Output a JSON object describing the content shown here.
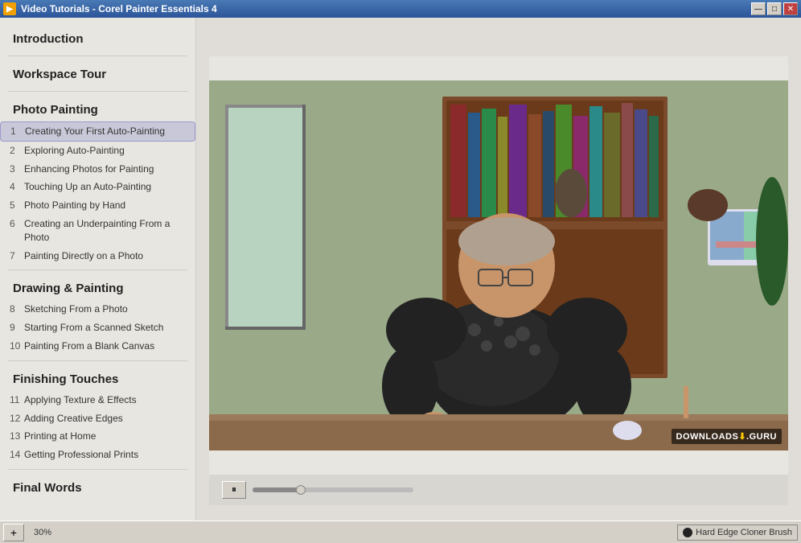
{
  "window": {
    "title": "Video Tutorials - Corel Painter Essentials 4",
    "controls": {
      "minimize": "—",
      "maximize": "□",
      "close": "✕"
    }
  },
  "sidebar": {
    "sections": [
      {
        "id": "intro",
        "title": "Introduction",
        "items": []
      },
      {
        "id": "workspace",
        "title": "Workspace Tour",
        "items": []
      },
      {
        "id": "photo-painting",
        "title": "Photo Painting",
        "items": [
          {
            "num": "1",
            "text": "Creating Your First Auto-Painting",
            "active": true
          },
          {
            "num": "2",
            "text": "Exploring Auto-Painting"
          },
          {
            "num": "3",
            "text": "Enhancing Photos for Painting"
          },
          {
            "num": "4",
            "text": "Touching Up an Auto-Painting"
          },
          {
            "num": "5",
            "text": "Photo Painting by Hand"
          },
          {
            "num": "6",
            "text": "Creating an Underpainting From a Photo"
          },
          {
            "num": "7",
            "text": "Painting Directly on a Photo"
          }
        ]
      },
      {
        "id": "drawing-painting",
        "title": "Drawing & Painting",
        "items": [
          {
            "num": "8",
            "text": "Sketching From a Photo"
          },
          {
            "num": "9",
            "text": "Starting From a Scanned Sketch"
          },
          {
            "num": "10",
            "text": "Painting From a Blank Canvas"
          }
        ]
      },
      {
        "id": "finishing-touches",
        "title": "Finishing Touches",
        "items": [
          {
            "num": "11",
            "text": "Applying Texture & Effects"
          },
          {
            "num": "12",
            "text": "Adding Creative Edges"
          },
          {
            "num": "13",
            "text": "Printing at Home"
          },
          {
            "num": "14",
            "text": "Getting Professional Prints"
          }
        ]
      },
      {
        "id": "final-words",
        "title": "Final Words",
        "items": []
      }
    ]
  },
  "video": {
    "watermark_text": "DOWNLOADS",
    "watermark_domain": ".GURU",
    "controls": {
      "pause_icon": "⏸",
      "progress_percent": 30
    }
  },
  "taskbar": {
    "add_button": "+",
    "zoom_label": "30%",
    "brush_label": "Hard Edge Cloner Brush"
  }
}
